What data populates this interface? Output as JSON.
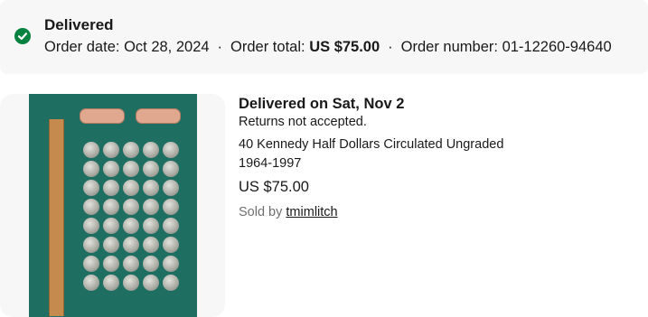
{
  "order_summary": {
    "status": "Delivered",
    "order_date_label": "Order date:",
    "order_date": "Oct 28, 2024",
    "order_total_label": "Order total:",
    "order_total": "US $75.00",
    "order_number_label": "Order number:",
    "order_number": "01-12260-94640",
    "separator": "·",
    "status_icon": "check-circle-icon",
    "status_color": "#05823f"
  },
  "item": {
    "delivery_status": "Delivered on Sat, Nov 2",
    "returns_policy": "Returns not accepted.",
    "title_line1": "40 Kennedy Half Dollars Circulated Ungraded",
    "title_line2": "1964-1997",
    "price": "US $75.00",
    "sold_by_label": "Sold by",
    "seller": "tmimlitch"
  }
}
